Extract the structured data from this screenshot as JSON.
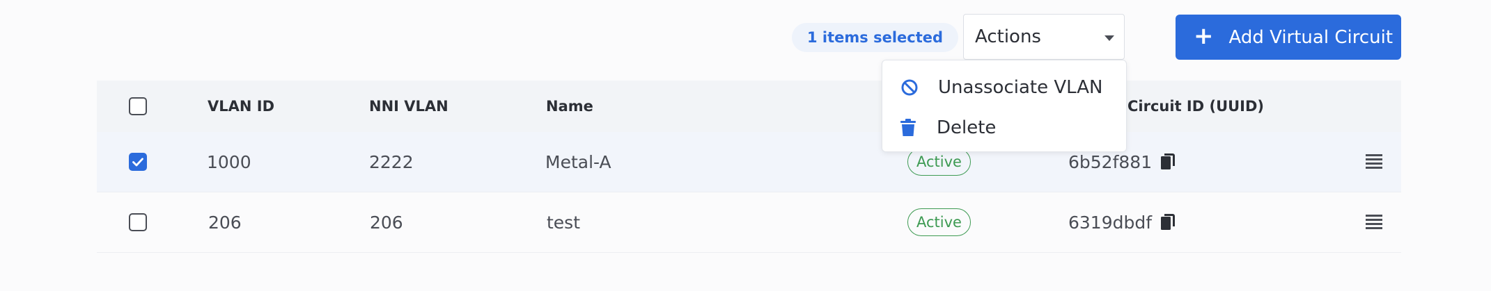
{
  "toolbar": {
    "selected_text": "1 items selected",
    "actions_label": "Actions",
    "add_button_label": "Add Virtual Circuit"
  },
  "actions_menu": {
    "items": [
      {
        "label": "Unassociate VLAN",
        "icon": "ban-icon"
      },
      {
        "label": "Delete",
        "icon": "trash-icon"
      }
    ]
  },
  "table": {
    "headers": {
      "vlan_id": "VLAN ID",
      "nni_vlan": "NNI VLAN",
      "name": "Name",
      "circuit_id": "Circuit ID (UUID)"
    },
    "rows": [
      {
        "checked": true,
        "vlan_id": "1000",
        "nni_vlan": "2222",
        "name": "Metal-A",
        "status": "Active",
        "uuid": "6b52f881"
      },
      {
        "checked": false,
        "vlan_id": "206",
        "nni_vlan": "206",
        "name": "test",
        "status": "Active",
        "uuid": "6319dbdf"
      }
    ]
  },
  "colors": {
    "accent": "#2b6bdc",
    "status_active": "#3d9a52",
    "header_bg": "#f2f4f7"
  }
}
